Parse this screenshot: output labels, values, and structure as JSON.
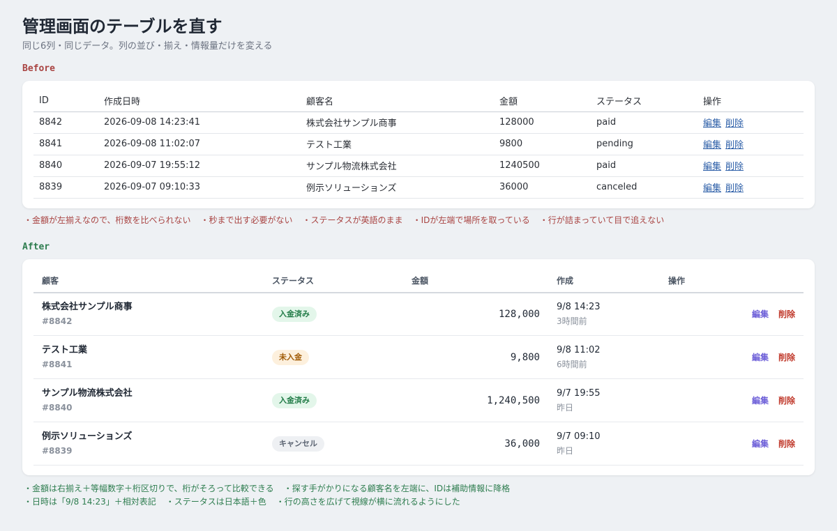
{
  "header": {
    "title": "管理画面のテーブルを直す",
    "subtitle": "同じ6列・同じデータ。列の並び・揃え・情報量だけを変える"
  },
  "before": {
    "label": "Before",
    "columns": [
      "ID",
      "作成日時",
      "顧客名",
      "金額",
      "ステータス",
      "操作"
    ],
    "rows": [
      {
        "id": "8842",
        "created": "2026-09-08 14:23:41",
        "customer": "株式会社サンプル商事",
        "amount": "128000",
        "status": "paid"
      },
      {
        "id": "8841",
        "created": "2026-09-08 11:02:07",
        "customer": "テスト工業",
        "amount": "9800",
        "status": "pending"
      },
      {
        "id": "8840",
        "created": "2026-09-07 19:55:12",
        "customer": "サンプル物流株式会社",
        "amount": "1240500",
        "status": "paid"
      },
      {
        "id": "8839",
        "created": "2026-09-07 09:10:33",
        "customer": "例示ソリューションズ",
        "amount": "36000",
        "status": "canceled"
      }
    ],
    "edit_label": "編集",
    "delete_label": "削除",
    "notes": [
      "・金額が左揃えなので、桁数を比べられない",
      "・秒まで出す必要がない",
      "・ステータスが英語のまま",
      "・IDが左端で場所を取っている",
      "・行が詰まっていて目で追えない"
    ]
  },
  "after": {
    "label": "After",
    "columns": [
      "顧客",
      "ステータス",
      "金額",
      "作成",
      "操作"
    ],
    "rows": [
      {
        "customer": "株式会社サンプル商事",
        "id": "#8842",
        "status": "入金済み",
        "amount": "128,000",
        "created": "9/8 14:23",
        "relative": "3時間前"
      },
      {
        "customer": "テスト工業",
        "id": "#8841",
        "status": "未入金",
        "amount": "9,800",
        "created": "9/8 11:02",
        "relative": "6時間前"
      },
      {
        "customer": "サンプル物流株式会社",
        "id": "#8840",
        "status": "入金済み",
        "amount": "1,240,500",
        "created": "9/7 19:55",
        "relative": "昨日"
      },
      {
        "customer": "例示ソリューションズ",
        "id": "#8839",
        "status": "キャンセル",
        "amount": "36,000",
        "created": "9/7 09:10",
        "relative": "昨日"
      }
    ],
    "edit_label": "編集",
    "delete_label": "削除",
    "notes_line1": [
      "・金額は右揃え＋等幅数字＋桁区切りで、桁がそろって比較できる",
      "・探す手がかりになる顧客名を左端に、IDは補助情報に降格"
    ],
    "notes_line2": [
      "・日時は「9/8 14:23」＋相対表記",
      "・ステータスは日本語＋色",
      "・行の高さを広げて視線が横に流れるようにした"
    ]
  },
  "colors": {
    "before_accent": "#a94442",
    "after_accent": "#2e7d4f",
    "edit": "#6d5fd8",
    "delete": "#c0392b",
    "paid_bg": "#e3f6ea",
    "pending_bg": "#fdf0dd",
    "cancel_bg": "#eef0f3"
  }
}
